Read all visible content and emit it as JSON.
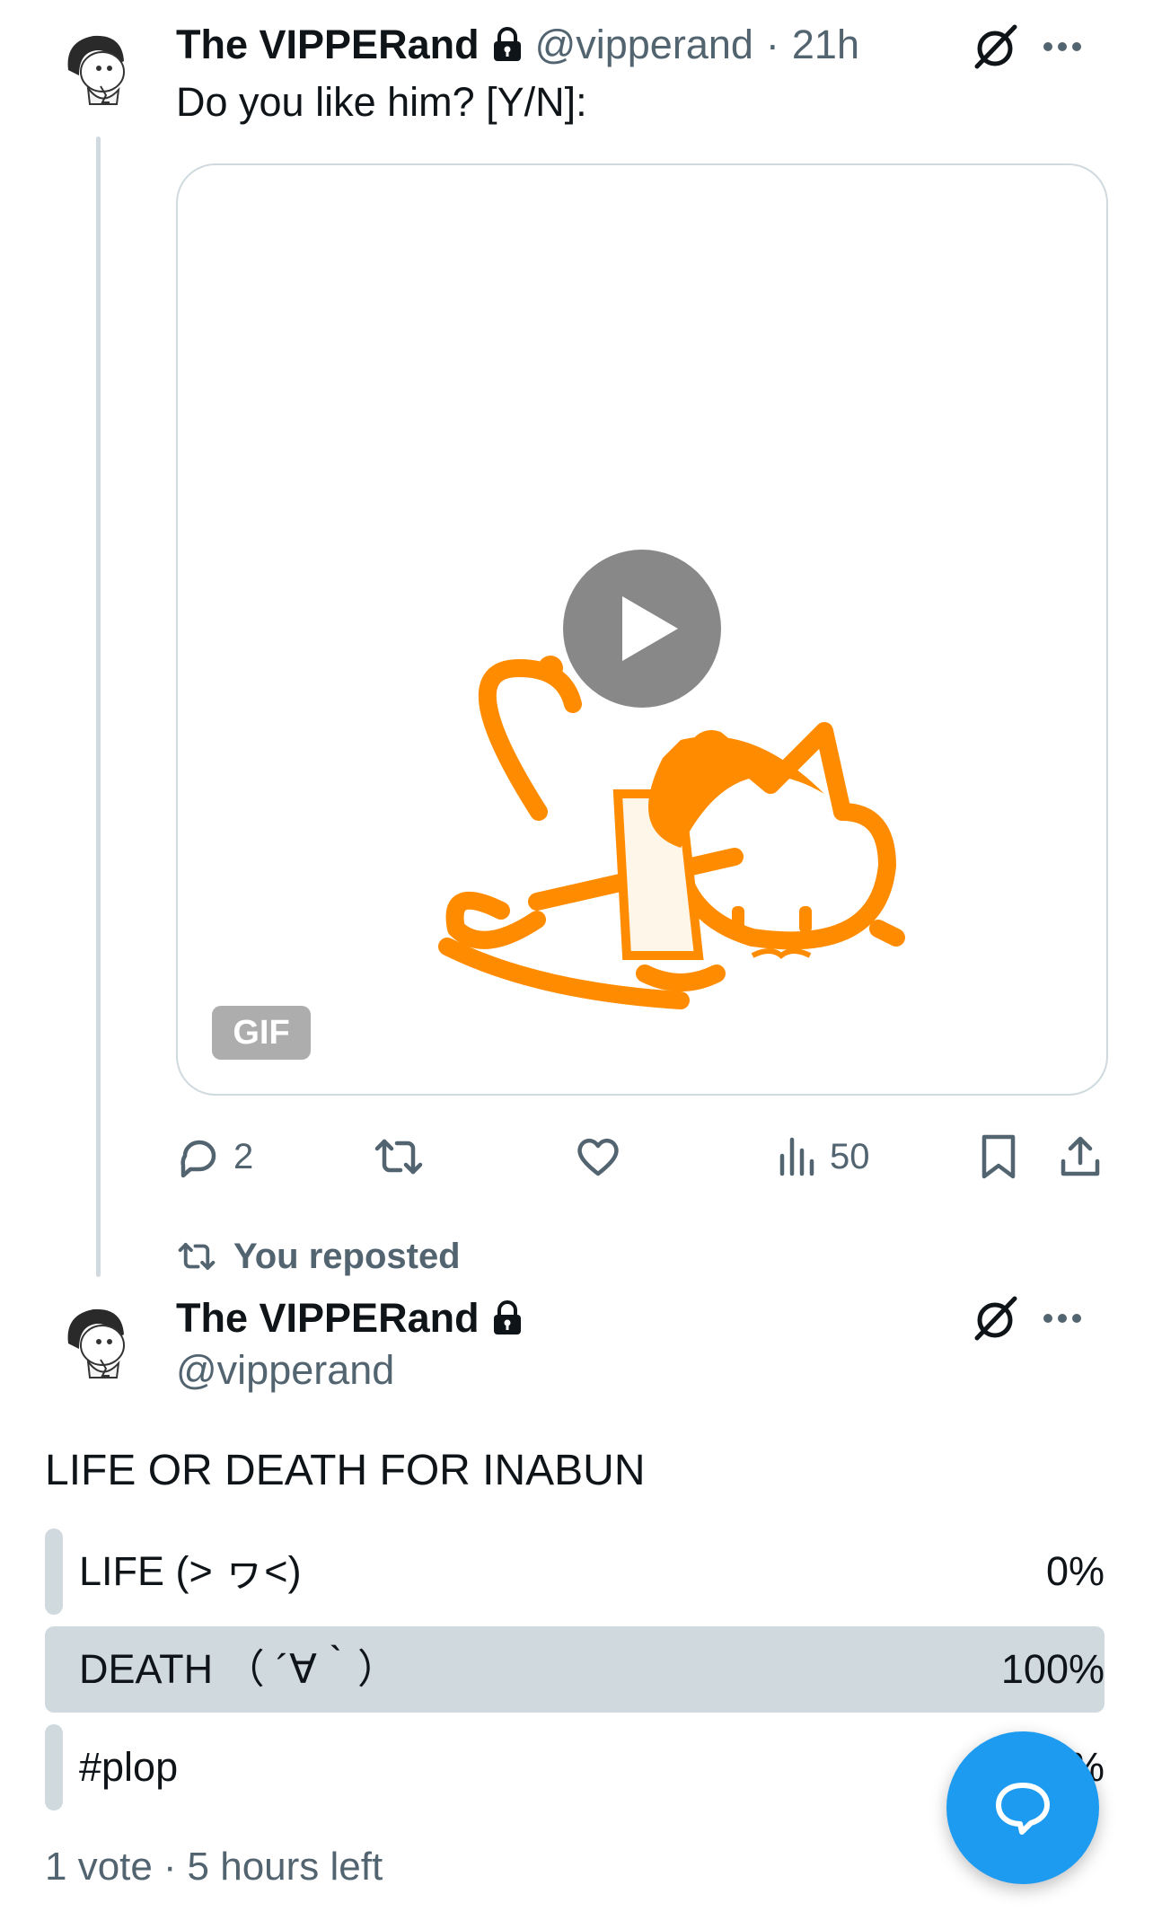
{
  "tweet1": {
    "display_name": "The VIPPERand",
    "handle": "@vipperand",
    "separator": "·",
    "time": "21h",
    "text": "Do you like him? [Y/N]:",
    "media_badge": "GIF",
    "actions": {
      "replies": "2",
      "views": "50"
    }
  },
  "tweet2": {
    "repost_label": "You reposted",
    "display_name": "The VIPPERand",
    "handle": "@vipperand",
    "text": "LIFE OR DEATH FOR INABUN",
    "poll": {
      "options": [
        {
          "label": "LIFE (˃ ヮ˂)",
          "percent": "0%",
          "fraction": 0
        },
        {
          "label": "DEATH （ ´∀｀）",
          "percent": "100%",
          "fraction": 1
        },
        {
          "label": "#plop",
          "percent": "0%",
          "fraction": 0
        }
      ],
      "votes": "1 vote",
      "separator": "·",
      "time_left": "5 hours left"
    }
  },
  "icons": {
    "lock": "lock-icon",
    "grok": "grok-icon",
    "more": "more-icon",
    "reply": "reply-icon",
    "repost": "repost-icon",
    "like": "heart-icon",
    "views": "views-icon",
    "bookmark": "bookmark-icon",
    "share": "share-icon",
    "fab": "new-message-icon"
  },
  "colors": {
    "accent": "#1d9bf0",
    "muted": "#536471",
    "poll_bar": "#cfd9de",
    "gif_orange": "#ff8c00"
  }
}
